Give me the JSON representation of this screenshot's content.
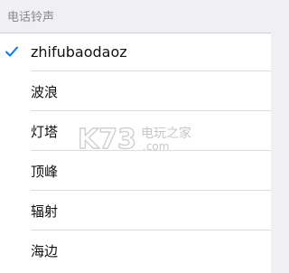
{
  "section_header": "电话铃声",
  "ringtones": [
    {
      "label": "zhifubaodaoz",
      "selected": true
    },
    {
      "label": "波浪",
      "selected": false
    },
    {
      "label": "灯塔",
      "selected": false
    },
    {
      "label": "顶峰",
      "selected": false
    },
    {
      "label": "辐射",
      "selected": false
    },
    {
      "label": "海边",
      "selected": false
    }
  ],
  "watermark": {
    "logo_text": "K73",
    "text_cn": "电玩之家",
    "text_en": ".com"
  },
  "colors": {
    "accent": "#007aff",
    "background": "#efeff4",
    "row_background": "#ffffff"
  },
  "icons": {
    "selected": "checkmark-icon"
  }
}
